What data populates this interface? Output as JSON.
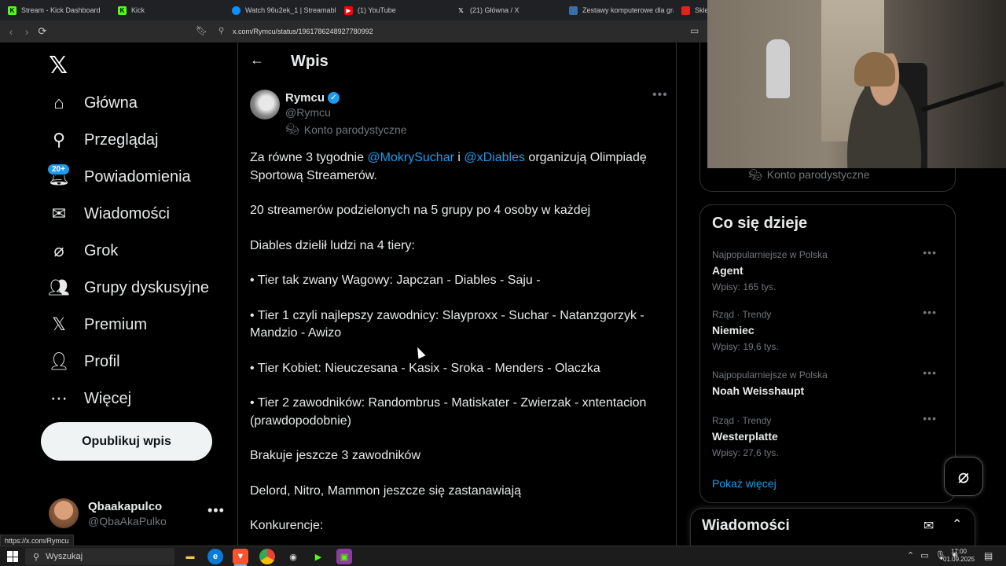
{
  "browser": {
    "tabs": [
      {
        "label": "Stream - Kick Dashboard",
        "icon": "kick-icon",
        "color": "#53fc18"
      },
      {
        "label": "Kick",
        "icon": "kick-icon",
        "color": "#53fc18"
      },
      {
        "label": "Watch 96u2ek_1 | Streamable",
        "icon": "streamable-icon",
        "color": "#0f90fa"
      },
      {
        "label": "(1) YouTube",
        "icon": "youtube-icon",
        "color": "#ff0000"
      },
      {
        "label": "(21) Główna / X",
        "icon": "x-icon",
        "color": "#ffffff"
      },
      {
        "label": "Zestawy komputerowe dla gra",
        "icon": "shop-icon",
        "color": "#3a6ea5"
      },
      {
        "label": "Sklep",
        "icon": "shop-icon",
        "color": "#e2231a"
      }
    ],
    "url": "x.com/Rymcu/status/1961786248927780992",
    "status_url": "https://x.com/Rymcu"
  },
  "sidebar": {
    "items": [
      {
        "label": "Główna",
        "icon": "home-icon"
      },
      {
        "label": "Przeglądaj",
        "icon": "search-icon"
      },
      {
        "label": "Powiadomienia",
        "icon": "bell-icon"
      },
      {
        "label": "Wiadomości",
        "icon": "mail-icon"
      },
      {
        "label": "Grok",
        "icon": "grok-icon"
      },
      {
        "label": "Grupy dyskusyjne",
        "icon": "people-icon"
      },
      {
        "label": "Premium",
        "icon": "x-icon"
      },
      {
        "label": "Profil",
        "icon": "person-icon"
      },
      {
        "label": "Więcej",
        "icon": "more-circle-icon"
      }
    ],
    "notifications_badge": "20+",
    "post_button": "Opublikuj wpis",
    "account": {
      "name": "Qbaakapulco",
      "handle": "@QbaAkaPulko"
    }
  },
  "main": {
    "header_title": "Wpis",
    "author": {
      "name": "Rymcu",
      "handle": "@Rymcu",
      "label": "Konto parodystyczne"
    },
    "tweet": {
      "p1_before": "Za równe 3 tygodnie ",
      "p1_mention1": "@MokrySuchar",
      "p1_mid": " i ",
      "p1_mention2": "@xDiables",
      "p1_after": " organizują Olimpiadę Sportową Streamerów.",
      "p2": "20 streamerów podzielonych na 5 grupy po 4 osoby w każdej",
      "p3": "Diables dzielił ludzi na 4 tiery:",
      "p4": "• Tier tak zwany Wagowy: Japczan - Diables - Saju -",
      "p5": "• Tier 1 czyli najlepszy zawodnicy: Slayproxx - Suchar - Natanzgorzyk - Mandzio - Awizo",
      "p6": "• Tier Kobiet: Nieuczesana - Kasix - Sroka - Menders - Olaczka",
      "p7": "• Tier 2 zawodników: Randombrus - Matiskater - Zwierzak - xntentacion (prawdopodobnie)",
      "p8": "Brakuje jeszcze 3 zawodników",
      "p9": "Delord, Nitro, Mammon jeszcze się zastanawiają",
      "p10": "Konkurencje:"
    }
  },
  "right": {
    "parody_label": "Konto parodystyczne",
    "trends_title": "Co się dzieje",
    "trends": [
      {
        "meta": "Najpopularniejsze w Polska",
        "name": "Agent",
        "count": "Wpisy: 165 tys."
      },
      {
        "meta": "Rząd · Trendy",
        "name": "Niemiec",
        "count": "Wpisy: 19,6 tys."
      },
      {
        "meta": "Najpopularniejsze w Polska",
        "name": "Noah Weisshaupt",
        "count": ""
      },
      {
        "meta": "Rząd · Trendy",
        "name": "Westerplatte",
        "count": "Wpisy: 27,6 tys."
      }
    ],
    "show_more": "Pokaż więcej",
    "messages_title": "Wiadomości"
  },
  "taskbar": {
    "search_placeholder": "Wyszukaj",
    "time": "17:00",
    "date": "01.09.2025"
  },
  "colors": {
    "accent": "#1d9bf0",
    "background": "#000000",
    "border": "#2f3336",
    "muted": "#71767b"
  }
}
